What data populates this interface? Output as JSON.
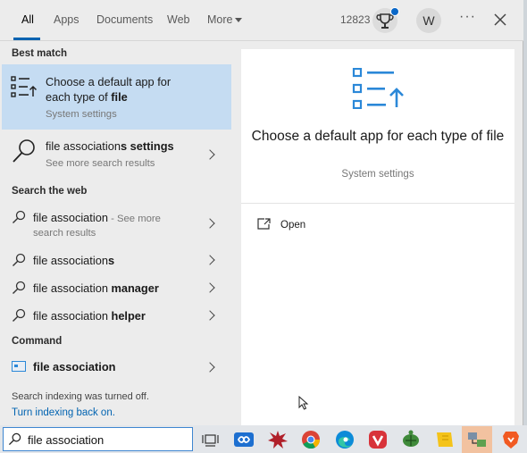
{
  "tabs": {
    "all": "All",
    "apps": "Apps",
    "documents": "Documents",
    "web": "Web",
    "more": "More"
  },
  "header": {
    "points": "12823",
    "avatar_initial": "W",
    "more_glyph": "···"
  },
  "sections": {
    "best_match": "Best match",
    "search_web": "Search the web",
    "command": "Command"
  },
  "best_match": {
    "title_line1": "Choose a default app for",
    "title_line2_prefix": "each type of ",
    "title_line2_bold": "file",
    "subtitle": "System settings"
  },
  "settings_result": {
    "title_prefix": "file association",
    "title_bold": "s settings",
    "subtitle": "See more search results"
  },
  "web_results": [
    {
      "prefix": "file association",
      "suffix": " - See more",
      "line2": "search results"
    },
    {
      "prefix": "file association",
      "bold": "s"
    },
    {
      "prefix": "file association ",
      "bold": "manager"
    },
    {
      "prefix": "file association ",
      "bold": "helper"
    }
  ],
  "command_result": {
    "label": "file association"
  },
  "notice": {
    "text": "Search indexing was turned off.",
    "link": "Turn indexing back on."
  },
  "preview": {
    "title": "Choose a default app for each type of file",
    "subtitle": "System settings",
    "open_label": "Open"
  },
  "search": {
    "value": "file association"
  },
  "colors": {
    "accent": "#0063b1",
    "selected_row": "#c5dcf2",
    "icon_blue": "#2b88d8"
  },
  "taskbar_icons": [
    "task-view-icon",
    "infinity-app-icon",
    "splat-app-icon",
    "chrome-icon",
    "edge-icon",
    "vivaldi-icon",
    "turtle-app-icon",
    "sticky-notes-icon",
    "network-app-icon",
    "brave-icon"
  ]
}
